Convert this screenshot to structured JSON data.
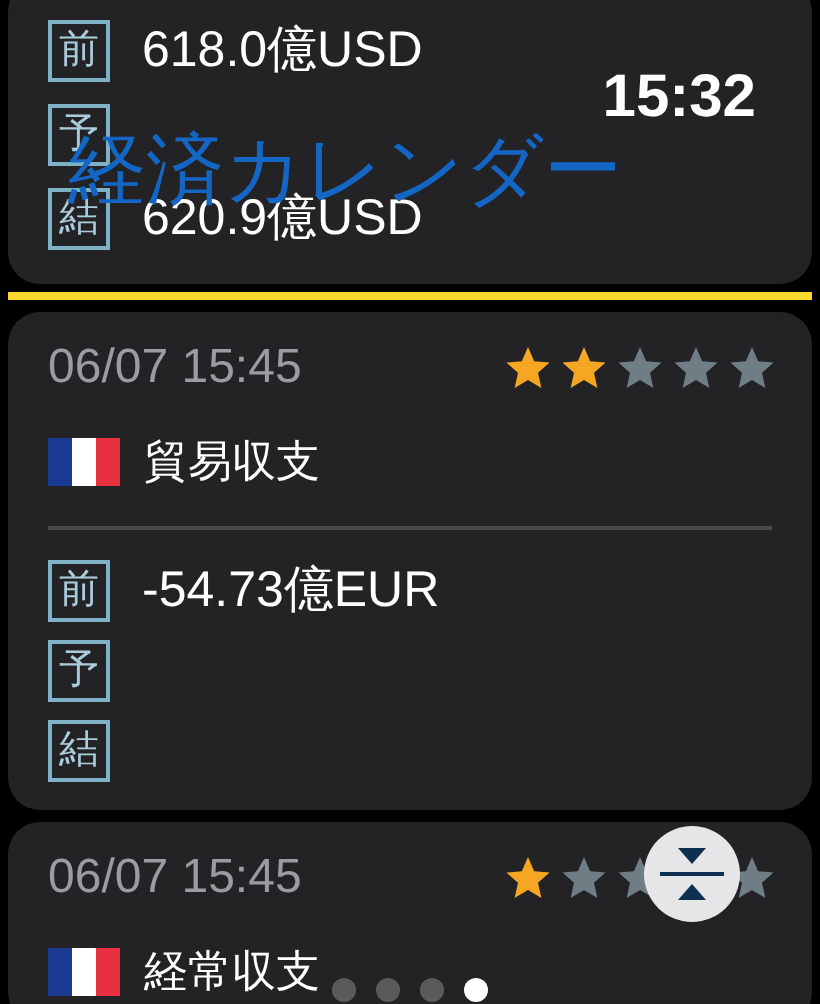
{
  "clock": "15:32",
  "app_title": "経済カレンダー",
  "events": [
    {
      "now_marker": true,
      "rows": [
        {
          "label": "前",
          "value": "618.0億USD"
        },
        {
          "label": "予"
        },
        {
          "label": "結",
          "value": "620.9億USD"
        }
      ]
    },
    {
      "date": "06/07 15:45",
      "stars": 2,
      "flag": {
        "kind": "france"
      },
      "name": "貿易収支",
      "rows": [
        {
          "label": "前",
          "value": "-54.73億EUR"
        },
        {
          "label": "予"
        },
        {
          "label": "結"
        }
      ]
    },
    {
      "date": "06/07 15:45",
      "stars": 1,
      "flag": {
        "kind": "france"
      },
      "name": "経常収支"
    }
  ],
  "page_dots": [
    {
      "selected": false
    },
    {
      "selected": false
    },
    {
      "selected": false
    },
    {
      "selected": true
    }
  ]
}
